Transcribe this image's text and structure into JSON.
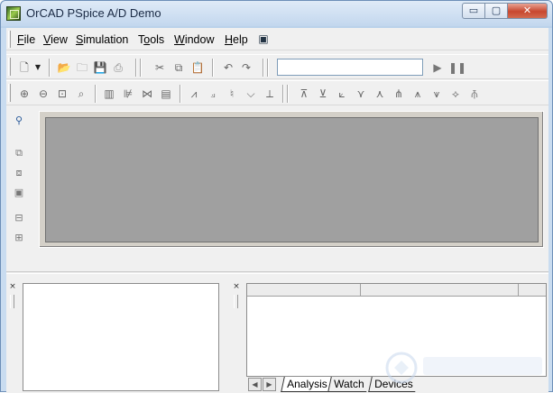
{
  "window": {
    "title": "OrCAD PSpice A/D Demo",
    "app_icon": "orcad-pspice-icon",
    "caption_buttons": [
      {
        "name": "minimize-button",
        "glyph": "▭"
      },
      {
        "name": "maximize-button",
        "glyph": "▢"
      },
      {
        "name": "close-button",
        "glyph": "✕"
      }
    ]
  },
  "menubar": {
    "items": [
      {
        "label_ul": "F",
        "label_rest": "ile"
      },
      {
        "label_ul": "V",
        "label_rest": "iew"
      },
      {
        "label_ul": "S",
        "label_rest": "imulation"
      },
      {
        "label_pre": "T",
        "label_ul": "o",
        "label_rest": "ols"
      },
      {
        "label_ul": "W",
        "label_rest": "indow"
      },
      {
        "label_ul": "H",
        "label_rest": "elp"
      }
    ],
    "extra_icon": "context-help-icon"
  },
  "toolbar1": {
    "icons": [
      "new-icon",
      "dropdown-arrow-icon",
      "open-icon",
      "open-folder-icon",
      "save-icon",
      "print-icon",
      "cut-icon",
      "copy-icon",
      "paste-icon",
      "undo-icon",
      "redo-icon"
    ],
    "profile_combo_value": "",
    "run_icon": "run-icon",
    "pause_icon": "pause-icon"
  },
  "toolbar2": {
    "icons": [
      "zoom-in-icon",
      "zoom-out-icon",
      "zoom-area-icon",
      "zoom-fit-icon",
      "toggle-grid-icon",
      "add-trace-icon",
      "fourier-icon",
      "performance-icon",
      "add-plot-icon",
      "add-y-axis-icon",
      "mark-data-icon",
      "toggle-cursor-icon",
      "cursor-peak-icon",
      "cursor-trough-icon",
      "cursor-slope-icon",
      "cursor-min-icon",
      "cursor-max-icon",
      "cursor-point-icon",
      "cursor-search-icon",
      "cursor-next-transition-icon",
      "cursor-prev-transition-icon",
      "mark-label-icon"
    ]
  },
  "left_strip": {
    "icons": [
      "pin-icon",
      "output-file-icon",
      "simulation-results-icon",
      "document-icon",
      "message-icon",
      "settings-icon"
    ]
  },
  "colors": {
    "titlebar": "#c3d7ee",
    "plot_area": "#a0a0a0",
    "client_bg": "#f0f0f0"
  },
  "output_pane": {
    "close_glyph": "×"
  },
  "sim_pane": {
    "close_glyph": "×",
    "tabs": [
      "Analysis",
      "Watch",
      "Devices"
    ],
    "active_tab": "Analysis",
    "scroll_left_glyph": "◀",
    "scroll_right_glyph": "▶"
  }
}
